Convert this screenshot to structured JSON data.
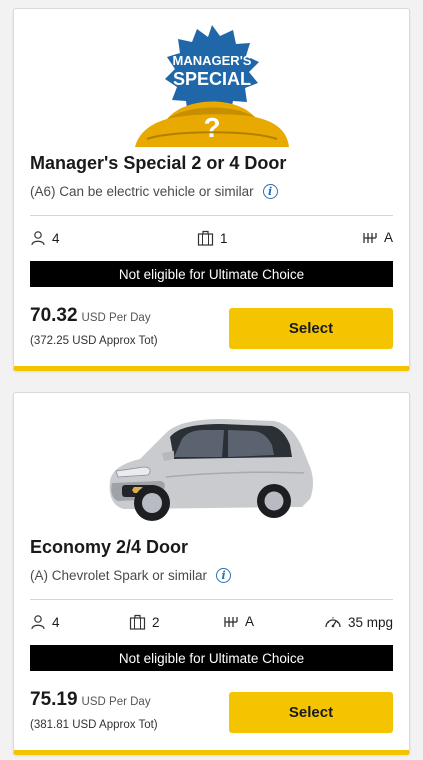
{
  "cards": [
    {
      "image_badge": {
        "line1": "MANAGER'S",
        "line2": "SPECIAL",
        "symbol": "?"
      },
      "title": "Manager's Special 2 or 4 Door",
      "subtitle": "(A6) Can be electric vehicle or similar",
      "specs": {
        "passengers": "4",
        "bags": "1",
        "transmission": "A"
      },
      "banner": "Not eligible for Ultimate Choice",
      "price": "70.32",
      "price_unit": "USD Per Day",
      "total": "(372.25 USD Approx Tot)",
      "select_label": "Select"
    },
    {
      "title": "Economy 2/4 Door",
      "subtitle": "(A) Chevrolet Spark or similar",
      "specs": {
        "passengers": "4",
        "bags": "2",
        "transmission": "A",
        "mpg": "35 mpg"
      },
      "banner": "Not eligible for Ultimate Choice",
      "price": "75.19",
      "price_unit": "USD Per Day",
      "total": "(381.81 USD Approx Tot)",
      "select_label": "Select"
    }
  ],
  "colors": {
    "accent": "#f5c400",
    "info": "#2a6fb5",
    "banner": "#000000"
  },
  "icons": [
    "person-icon",
    "luggage-icon",
    "transmission-icon",
    "mpg-gauge-icon",
    "info-icon"
  ]
}
